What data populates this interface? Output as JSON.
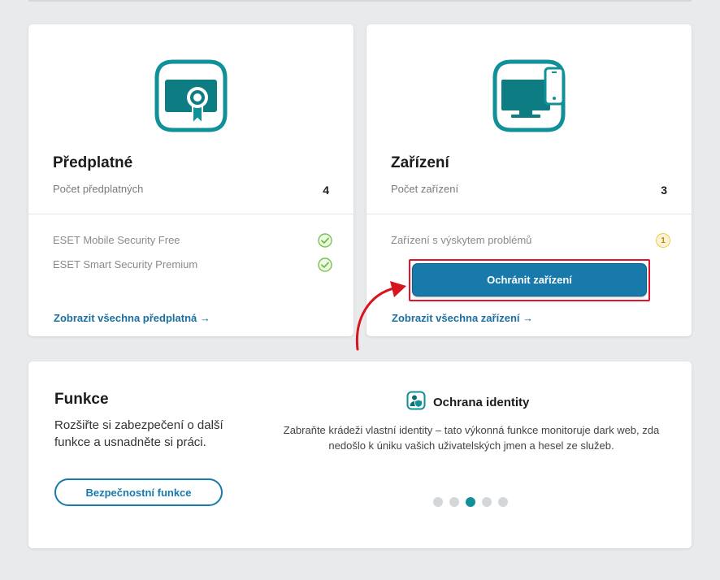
{
  "subscription_card": {
    "title": "Předplatné",
    "count_label": "Počet předplatných",
    "count_value": "4",
    "items": [
      {
        "name": "ESET Mobile Security Free",
        "status_icon": "check-circle-icon"
      },
      {
        "name": "ESET Smart Security Premium",
        "status_icon": "check-circle-icon"
      }
    ],
    "link_label": "Zobrazit všechna předplatná →",
    "icon": "certificate-icon"
  },
  "devices_card": {
    "title": "Zařízení",
    "count_label": "Počet zařízení",
    "count_value": "3",
    "problem_label": "Zařízení s výskytem problémů",
    "problem_count": "1",
    "primary_button": "Ochránit zařízení",
    "link_label": "Zobrazit všechna zařízení →",
    "icon": "monitor-phone-icon"
  },
  "features_card": {
    "title": "Funkce",
    "description": "Rozšiřte si zabezpečení o další funkce a usnadněte si práci.",
    "button_label": "Bezpečnostní funkce",
    "slide": {
      "title": "Ochrana identity",
      "icon": "identity-icon",
      "description": "Zabraňte krádeži vlastní identity – tato výkonná funkce monitoruje dark web, zda nedošlo k úniku vašich uživatelských jmen a hesel ze služeb."
    },
    "carousel": {
      "total": 5,
      "active_index": 2
    }
  },
  "colors": {
    "accent_teal": "#109199",
    "primary_blue": "#177aab",
    "link_blue": "#1a6f9e",
    "annotation_red": "#e2142d",
    "check_green": "#6cbf3e",
    "warning_yellow": "#f2c94c"
  }
}
